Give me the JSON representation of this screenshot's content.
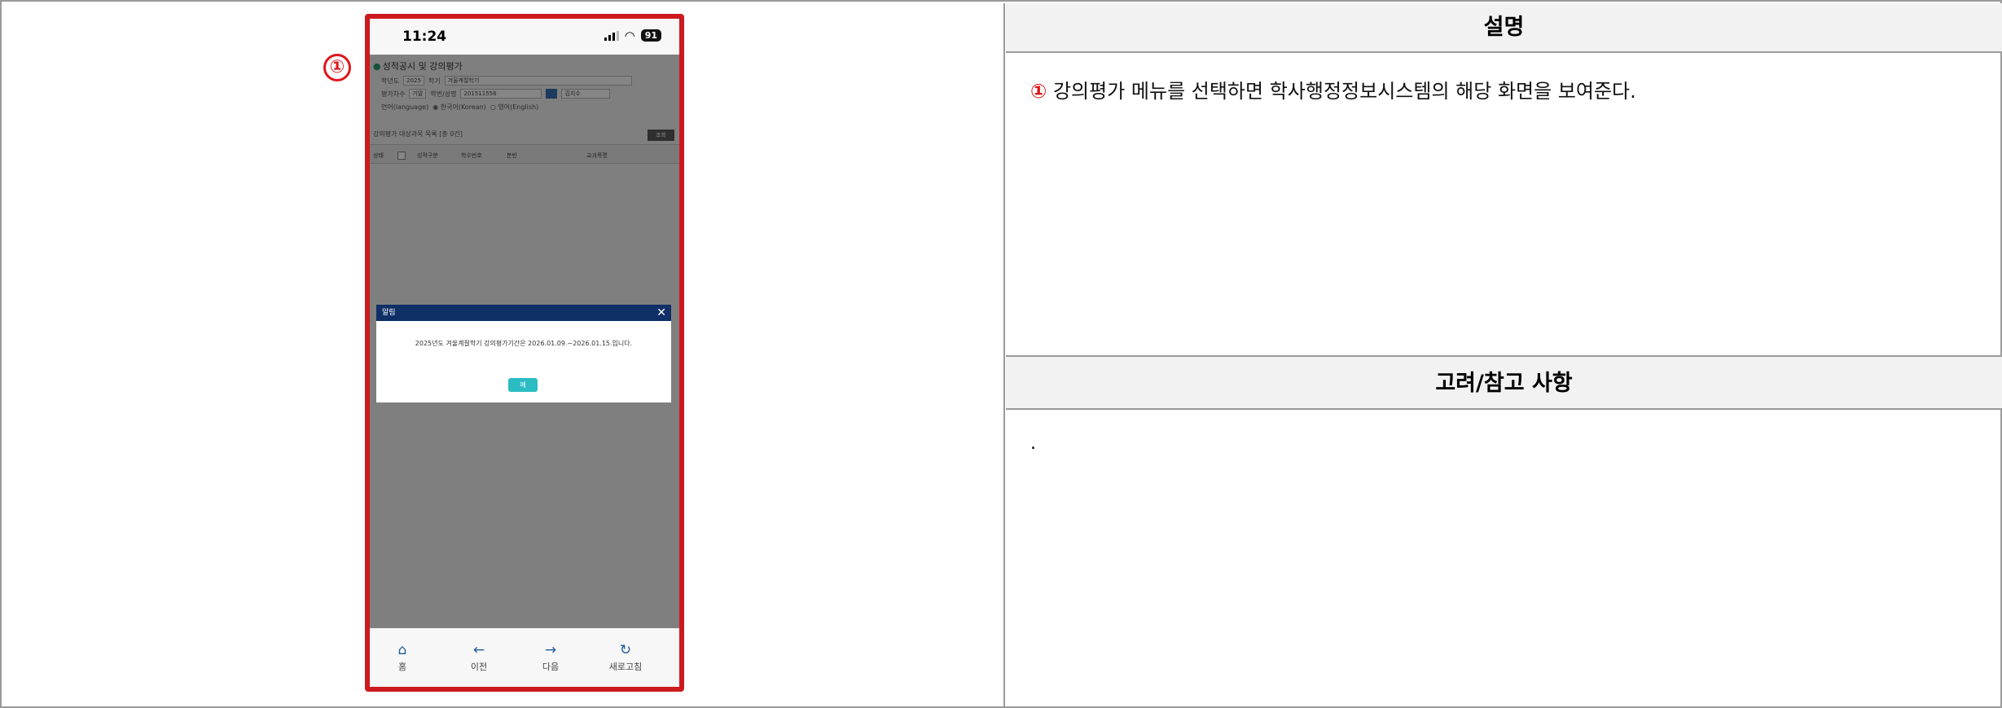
{
  "marker": "①",
  "phone": {
    "time": "11:24",
    "battery": "91",
    "app_title": "성적공시 및 강의평가",
    "form": {
      "year_label": "학년도",
      "year_value": "2025",
      "semester_label": "학기",
      "semester_value": "겨울계절학기",
      "round_label": "평가차수",
      "round_value": "기말",
      "student_label": "학번/성명",
      "student_id": "201511556",
      "student_name": "김지수",
      "language_label": "언어(language)",
      "lang_ko": "한국어(Korean)",
      "lang_en": "영어(English)"
    },
    "list_title": "강의평가 대상과목 목록 [총 0건]",
    "query_button": "조회",
    "columns": [
      "상태",
      "성적구분",
      "학수번호",
      "분반",
      "교과목명"
    ],
    "dialog": {
      "title": "알림",
      "message": "2025년도 겨울계절학기 강의평가기간은 2026.01.09.~2026.01.15.입니다.",
      "ok": "예"
    },
    "nav": [
      {
        "label": "홈",
        "icon": "home-icon"
      },
      {
        "label": "이전",
        "icon": "arrow-left-icon"
      },
      {
        "label": "다음",
        "icon": "arrow-right-icon"
      },
      {
        "label": "새로고침",
        "icon": "refresh-icon"
      }
    ]
  },
  "right": {
    "description_header": "설명",
    "description_num": "①",
    "description_text": " 강의평가 메뉴를 선택하면 학사행정정보시스템의 해당 화면을 보여준다.",
    "notes_header": "고려/참고 사항",
    "notes_text": "."
  },
  "colors": {
    "border_red": "#cc1a1e",
    "marker_red": "#e0161b",
    "dialog_navy": "#0f2f66",
    "ok_teal": "#2bbcc4"
  }
}
